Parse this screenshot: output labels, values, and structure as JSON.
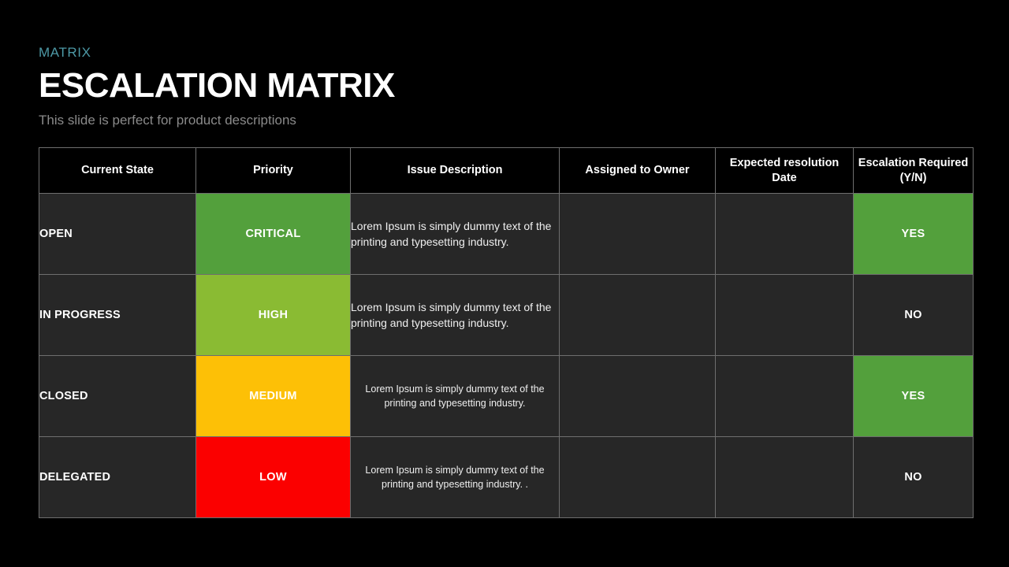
{
  "slide": {
    "eyebrow": "MATRIX",
    "title": "ESCALATION MATRIX",
    "subtitle": "This slide is perfect for product descriptions"
  },
  "colors": {
    "accent_teal": "#4d99a6",
    "critical_green": "#53a03c",
    "high_green": "#8abb33",
    "medium_amber": "#fdc006",
    "low_red": "#fb0000",
    "cell_dark": "#272727",
    "header_black": "#000000",
    "grid_line": "#6e6e6e",
    "subtitle_gray": "#8a8a8a"
  },
  "table": {
    "headers": [
      "Current State",
      "Priority",
      "Issue Description",
      "Assigned to Owner",
      "Expected resolution Date",
      "Escalation Required (Y/N)"
    ],
    "rows": [
      {
        "state": "OPEN",
        "priority": "CRITICAL",
        "priority_color": "#53a03c",
        "issue": "Lorem Ipsum is simply dummy text of the printing and typesetting industry.",
        "issue_align": "left",
        "owner": "",
        "date": "",
        "escalation": "YES",
        "escalation_color": "#53a03c"
      },
      {
        "state": "IN PROGRESS",
        "priority": "HIGH",
        "priority_color": "#8abb33",
        "issue": "Lorem Ipsum is simply dummy text of the printing and typesetting industry.",
        "issue_align": "left",
        "owner": "",
        "date": "",
        "escalation": "NO",
        "escalation_color": "#272727"
      },
      {
        "state": "CLOSED",
        "priority": "MEDIUM",
        "priority_color": "#fdc006",
        "issue": "Lorem Ipsum is simply dummy text of the printing and typesetting industry.",
        "issue_align": "center",
        "owner": "",
        "date": "",
        "escalation": "YES",
        "escalation_color": "#53a03c"
      },
      {
        "state": "DELEGATED",
        "priority": "LOW",
        "priority_color": "#fb0000",
        "issue": "Lorem Ipsum is simply dummy text of the printing and typesetting industry. .",
        "issue_align": "center",
        "owner": "",
        "date": "",
        "escalation": "NO",
        "escalation_color": "#272727"
      }
    ]
  }
}
